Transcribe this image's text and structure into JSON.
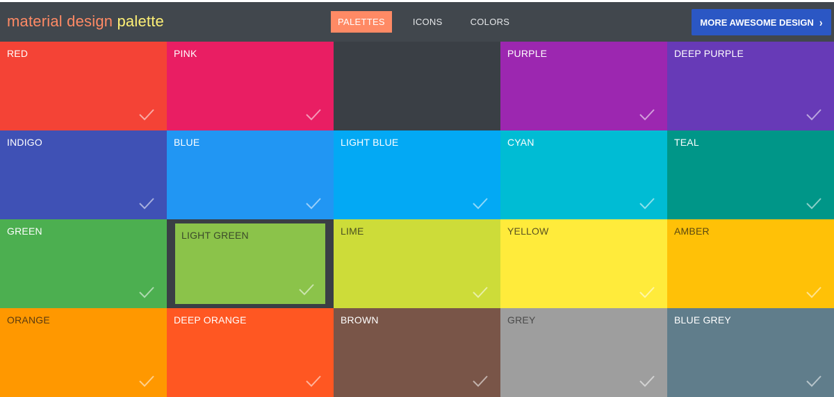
{
  "header": {
    "brand_part1": "material design",
    "brand_part2": "palette",
    "nav": [
      {
        "label": "PALETTES",
        "active": true
      },
      {
        "label": "ICONS",
        "active": false
      },
      {
        "label": "COLORS",
        "active": false
      }
    ],
    "cta_label": "MORE AWESOME DESIGN",
    "cta_icon": "chevron-right-icon"
  },
  "palettes": [
    {
      "label": "RED",
      "color": "#f44336",
      "text": "#ffffff"
    },
    {
      "label": "PINK",
      "color": "#e91e63",
      "text": "#ffffff"
    },
    {
      "label": "",
      "color": "#3a3f45",
      "text": "#ffffff"
    },
    {
      "label": "PURPLE",
      "color": "#9c27b0",
      "text": "#ffffff"
    },
    {
      "label": "DEEP PURPLE",
      "color": "#673ab7",
      "text": "#ffffff"
    },
    {
      "label": "INDIGO",
      "color": "#3f51b5",
      "text": "#ffffff"
    },
    {
      "label": "BLUE",
      "color": "#2196f3",
      "text": "#ffffff"
    },
    {
      "label": "LIGHT BLUE",
      "color": "#03a9f4",
      "text": "#ffffff"
    },
    {
      "label": "CYAN",
      "color": "#00bcd4",
      "text": "#ffffff"
    },
    {
      "label": "TEAL",
      "color": "#009688",
      "text": "#ffffff"
    },
    {
      "label": "GREEN",
      "color": "#4caf50",
      "text": "#ffffff"
    },
    {
      "label": "LIGHT GREEN",
      "color": "#8bc34a",
      "text": "#3b4a2a",
      "selected": true
    },
    {
      "label": "LIME",
      "color": "#cddc39",
      "text": "#4a5020"
    },
    {
      "label": "YELLOW",
      "color": "#ffeb3b",
      "text": "#5a5220"
    },
    {
      "label": "AMBER",
      "color": "#ffc107",
      "text": "#5a4810"
    },
    {
      "label": "ORANGE",
      "color": "#ff9800",
      "text": "#5a3a10"
    },
    {
      "label": "DEEP ORANGE",
      "color": "#ff5722",
      "text": "#ffffff"
    },
    {
      "label": "BROWN",
      "color": "#795548",
      "text": "#ffffff"
    },
    {
      "label": "GREY",
      "color": "#9e9e9e",
      "text": "#4a4a4a"
    },
    {
      "label": "BLUE GREY",
      "color": "#607d8b",
      "text": "#ffffff"
    }
  ],
  "check_icon": "check-icon"
}
